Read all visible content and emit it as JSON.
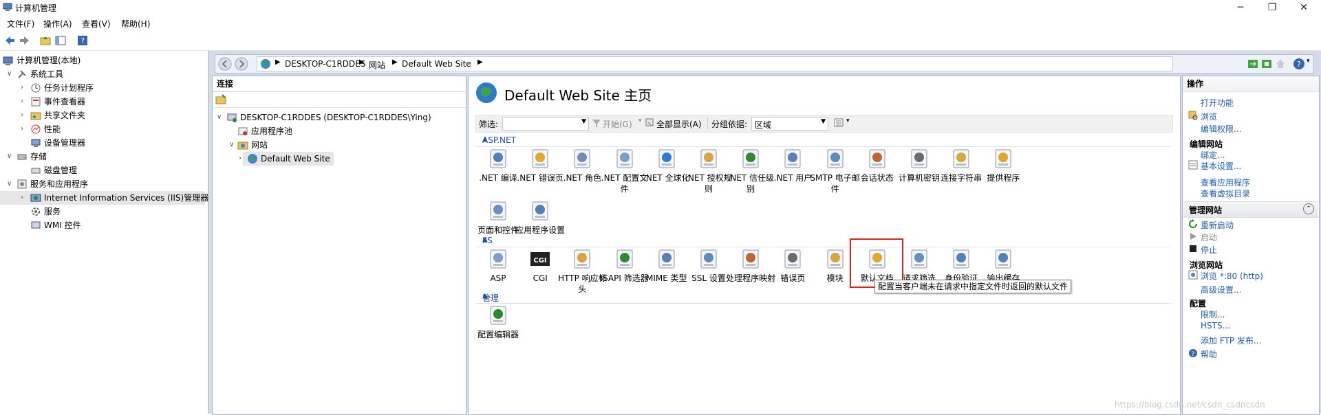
{
  "window": {
    "title": "计算机管理",
    "minimize": "─",
    "maximize": "❐",
    "close": "✕"
  },
  "menu": [
    "文件(F)",
    "操作(A)",
    "查看(V)",
    "帮助(H)"
  ],
  "tree": {
    "root": "计算机管理(本地)",
    "items": [
      {
        "label": "系统工具"
      },
      {
        "label": "任务计划程序"
      },
      {
        "label": "事件查看器"
      },
      {
        "label": "共享文件夹"
      },
      {
        "label": "性能"
      },
      {
        "label": "设备管理器"
      },
      {
        "label": "存储"
      },
      {
        "label": "磁盘管理"
      },
      {
        "label": "服务和应用程序"
      },
      {
        "label": "Internet Information Services (IIS)管理器"
      },
      {
        "label": "服务"
      },
      {
        "label": "WMI 控件"
      }
    ]
  },
  "breadcrumb": [
    "DESKTOP-C1RDDES",
    "网站",
    "Default Web Site"
  ],
  "connections": {
    "title": "连接",
    "server": "DESKTOP-C1RDDES (DESKTOP-C1RDDES\\Ying)",
    "app_pools": "应用程序池",
    "sites": "网站",
    "site": "Default Web Site"
  },
  "main": {
    "title": "Default Web Site 主页",
    "filter_label": "筛选:",
    "start_label": "开始(G)",
    "show_all_label": "全部显示(A)",
    "group_label": "分组依据:",
    "group_value": "区域",
    "sections": {
      "aspnet": "ASP.NET",
      "iis": "IIS",
      "manage": "管理"
    },
    "aspnet_features": [
      ".NET 编译",
      ".NET 错误页",
      ".NET 角色",
      ".NET 配置文件",
      ".NET 全球化",
      ".NET 授权规则",
      ".NET 信任级别",
      ".NET 用户",
      "SMTP 电子邮件",
      "会话状态",
      "计算机密钥",
      "连接字符串",
      "提供程序",
      "页面和控件",
      "应用程序设置"
    ],
    "iis_features": [
      "ASP",
      "CGI",
      "HTTP 响应标头",
      "ISAPI 筛选器",
      "MIME 类型",
      "SSL 设置",
      "处理程序映射",
      "错误页",
      "模块",
      "默认文档",
      "请求筛选",
      "身份验证",
      "输出缓存"
    ],
    "manage_features": [
      "配置编辑器"
    ],
    "tooltip": "配置当客户端未在请求中指定文件时返回的默认文件",
    "cgi_text": "CGI"
  },
  "actions": {
    "title": "操作",
    "open_feature": "打开功能",
    "browse": "浏览",
    "edit_perms": "编辑权限...",
    "edit_site": "编辑网站",
    "bindings": "绑定...",
    "basic_settings": "基本设置...",
    "view_apps": "查看应用程序",
    "view_vdirs": "查看虚拟目录",
    "manage_site": "管理网站",
    "restart": "重新启动",
    "start": "启动",
    "stop": "停止",
    "browse_site": "浏览网站",
    "browse_80": "浏览 *:80 (http)",
    "advanced": "高级设置...",
    "config": "配置",
    "limits": "限制...",
    "hsts": "HSTS...",
    "ftp": "添加 FTP 发布...",
    "help": "帮助"
  },
  "watermark": "https://blog.csdn.net/csdn_csdncsdn"
}
